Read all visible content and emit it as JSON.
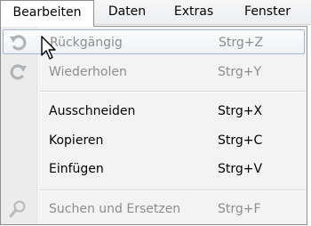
{
  "menubar": {
    "items": [
      {
        "label": "Bearbeiten",
        "active": true
      },
      {
        "label": "Daten"
      },
      {
        "label": "Extras"
      },
      {
        "label": "Fenster"
      }
    ]
  },
  "menu": {
    "items": [
      {
        "label": "Rückgängig",
        "shortcut": "Strg+Z",
        "icon": "undo-icon",
        "disabled": true,
        "hover": true
      },
      {
        "label": "Wiederholen",
        "shortcut": "Strg+Y",
        "icon": "redo-icon",
        "disabled": true
      },
      {
        "label": "Ausschneiden",
        "shortcut": "Strg+X"
      },
      {
        "label": "Kopieren",
        "shortcut": "Strg+C"
      },
      {
        "label": "Einfügen",
        "shortcut": "Strg+V"
      },
      {
        "label": "Suchen und Ersetzen",
        "shortcut": "Strg+F",
        "icon": "search-icon",
        "disabled": true
      }
    ]
  },
  "colors": {
    "disabled_text": "#8d8d8d",
    "hover_border": "#a8b8cc"
  }
}
